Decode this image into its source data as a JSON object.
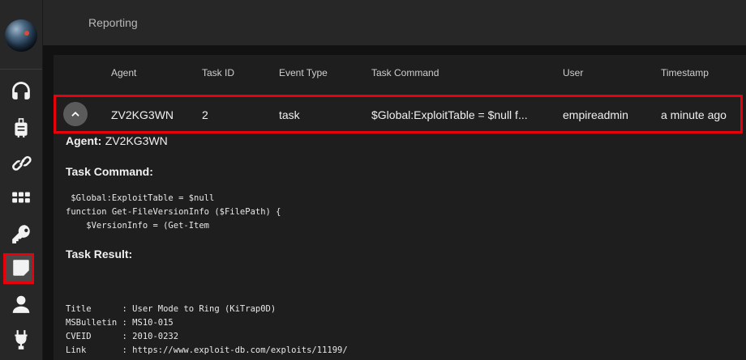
{
  "header": {
    "title": "Reporting"
  },
  "sidebar": {
    "items": [
      {
        "name": "listeners",
        "icon": "headphones-icon",
        "active": false
      },
      {
        "name": "stagers",
        "icon": "suitcase-icon",
        "active": false
      },
      {
        "name": "agents",
        "icon": "link-icon",
        "active": false
      },
      {
        "name": "modules",
        "icon": "grid-icon",
        "active": false
      },
      {
        "name": "credentials",
        "icon": "key-icon",
        "active": false
      },
      {
        "name": "reporting",
        "icon": "note-icon",
        "active": true
      },
      {
        "name": "users",
        "icon": "user-icon",
        "active": false
      },
      {
        "name": "plugins",
        "icon": "plug-icon",
        "active": false
      }
    ]
  },
  "table": {
    "columns": [
      "Agent",
      "Task ID",
      "Event Type",
      "Task Command",
      "User",
      "Timestamp"
    ],
    "rows": [
      {
        "agent": "ZV2KG3WN",
        "task_id": "2",
        "event_type": "task",
        "task_command": "$Global:ExploitTable = $null f...",
        "user": "empireadmin",
        "timestamp": "a minute ago"
      }
    ]
  },
  "detail": {
    "agent_label": "Agent:",
    "agent_value": "ZV2KG3WN",
    "task_command_label": "Task Command:",
    "task_command_text": " $Global:ExploitTable = $null\nfunction Get-FileVersionInfo ($FilePath) {\n    $VersionInfo = (Get-Item",
    "task_result_label": "Task Result:",
    "task_result_text": "Title      : User Mode to Ring (KiTrap0D)\nMSBulletin : MS10-015\nCVEID      : 2010-0232\nLink       : https://www.exploit-db.com/exploits/11199/"
  },
  "colors": {
    "highlight": "#e8000b",
    "background": "#121212",
    "panel": "#1e1e1e"
  }
}
